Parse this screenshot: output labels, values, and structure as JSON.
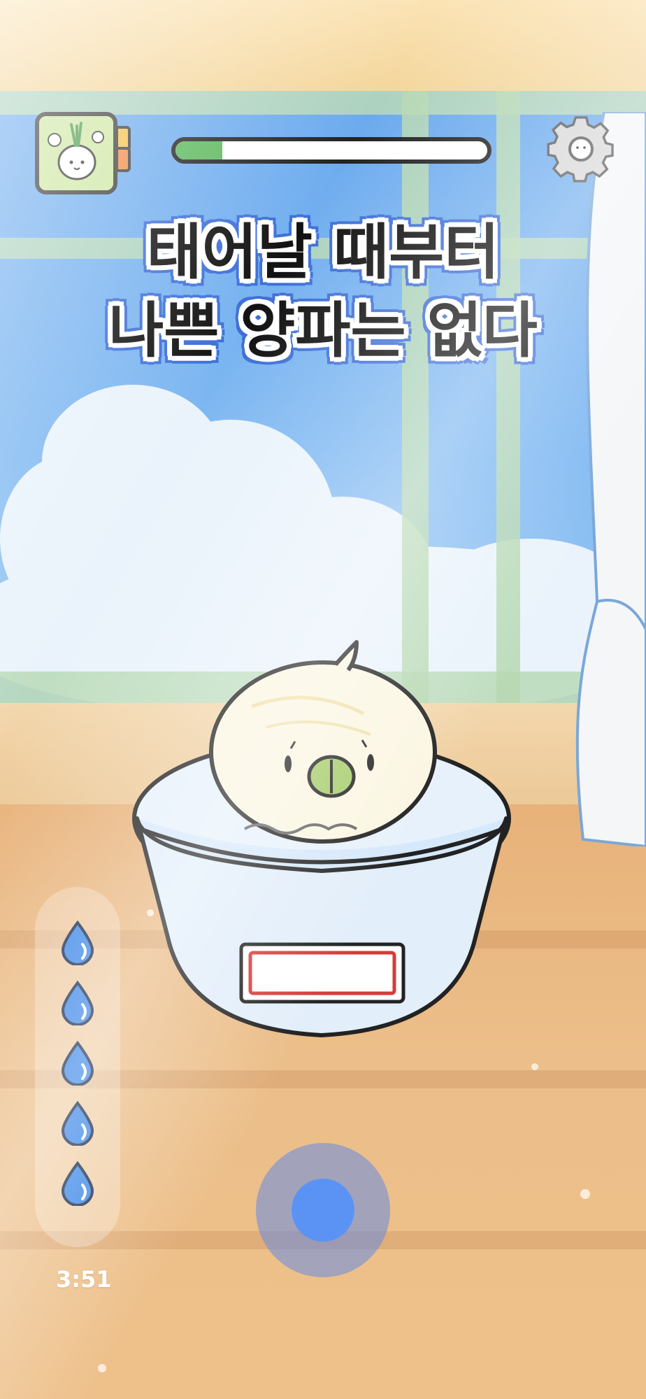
{
  "title": {
    "line1": "태어날 때부터",
    "line2": "나쁜 양파는 없다"
  },
  "progress": {
    "value": 0.15,
    "fill_color": "#5cb85c"
  },
  "status": {
    "timer": "3:51"
  },
  "water": {
    "drops_remaining": 5,
    "drop_icon": "water-drop-icon"
  },
  "icons": {
    "app": "onion-character-icon",
    "settings": "gear-icon"
  },
  "colors": {
    "title_outline": "#3d6ed8",
    "joystick": "#5b93f5",
    "bowl_label_border": "#d83a3a"
  }
}
